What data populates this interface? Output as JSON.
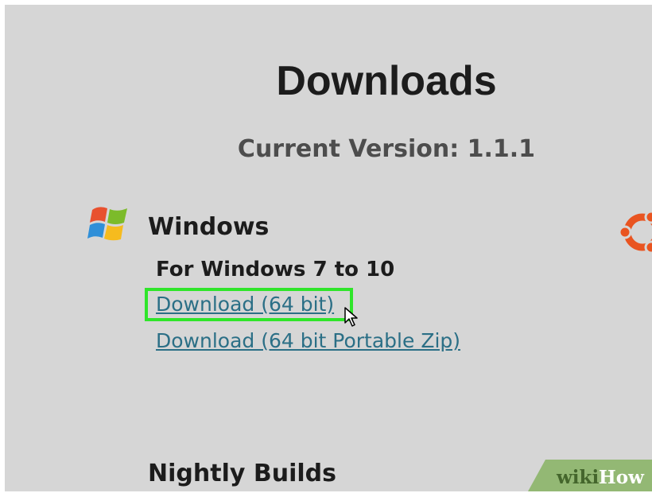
{
  "header": {
    "title": "Downloads",
    "version_label": "Current Version: 1.1.1"
  },
  "windows": {
    "icon": "windows-logo-icon",
    "title": "Windows",
    "subtitle": "For Windows 7 to 10",
    "links": [
      {
        "label": "Download (64 bit)",
        "highlighted": true
      },
      {
        "label": "Download (64 bit Portable Zip)",
        "highlighted": false
      }
    ]
  },
  "ubuntu": {
    "icon": "ubuntu-logo-icon"
  },
  "nightly": {
    "title": "Nightly Builds"
  },
  "watermark": {
    "text_part1": "wiki",
    "text_part2": "How"
  },
  "colors": {
    "background": "#d6d6d6",
    "link": "#2b6f86",
    "highlight": "#2fe52a",
    "ubuntu": "#e95420"
  }
}
